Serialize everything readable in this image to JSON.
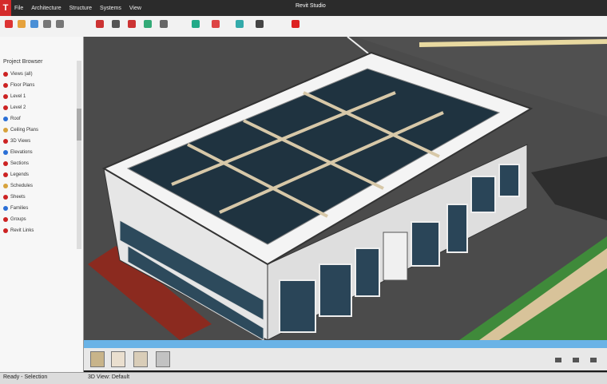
{
  "app": {
    "logo": "T",
    "window_title": "Revit Studio"
  },
  "menu": [
    "File",
    "Architecture",
    "Structure",
    "Systems",
    "View"
  ],
  "toolbar_icons": [
    "new-icon",
    "open-icon",
    "save-icon",
    "undo-icon",
    "redo-icon",
    "wall-icon",
    "door-icon",
    "window-icon",
    "roof-icon",
    "floor-icon",
    "stair-icon",
    "measure-icon",
    "tag-icon",
    "section-icon",
    "render-icon"
  ],
  "sidebar": {
    "title": "Project Browser",
    "items": [
      "Views (all)",
      "Floor Plans",
      "Level 1",
      "Level 2",
      "Roof",
      "Ceiling Plans",
      "3D Views",
      "Elevations",
      "Sections",
      "Legends",
      "Schedules",
      "Sheets",
      "Families",
      "Groups",
      "Revit Links"
    ]
  },
  "thumbnails": [
    "view-1",
    "view-2",
    "view-3",
    "view-4"
  ],
  "status": {
    "left": "Ready - Selection",
    "right": "3D View: Default"
  },
  "colors": {
    "accent": "#d42a2a",
    "status_bar": "#6ab3e6"
  }
}
